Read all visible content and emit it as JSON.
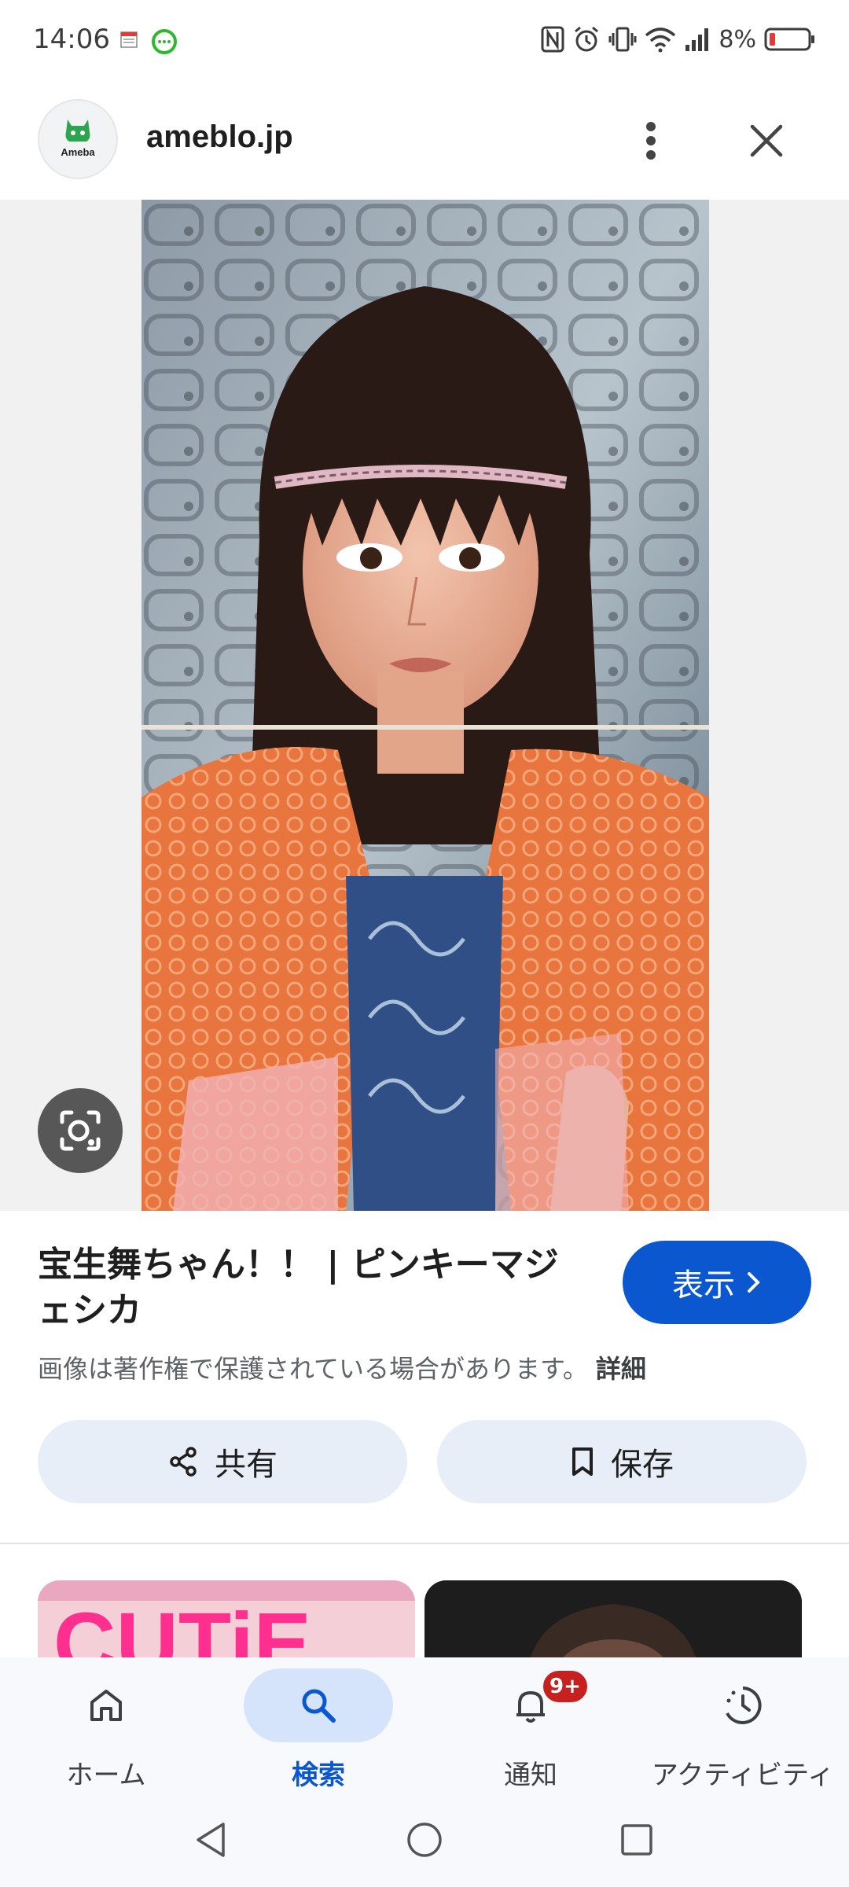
{
  "status_bar": {
    "time": "14:06",
    "battery": "8%",
    "icons": [
      "calendar-icon",
      "chat-icon",
      "nfc-icon",
      "alarm-icon",
      "vibrate-icon",
      "wifi-icon",
      "signal-icon",
      "battery-icon"
    ],
    "battery_color": "#e53935"
  },
  "header": {
    "logo_text": "Ameba",
    "domain": "ameblo.jp"
  },
  "image": {
    "title": "宝生舞ちゃん！！ | ピンキーマジェシカ",
    "visit_label": "表示",
    "copyright_notice": "画像は著作権で保護されている場合があります。",
    "details_label": "詳細"
  },
  "actions": {
    "share_label": "共有",
    "save_label": "保存"
  },
  "related": {
    "thumb1_text": "CUTiE"
  },
  "bottom_nav": {
    "items": [
      {
        "label": "ホーム",
        "icon": "home-icon"
      },
      {
        "label": "検索",
        "icon": "search-icon",
        "active": true
      },
      {
        "label": "通知",
        "icon": "bell-icon",
        "badge": "9+"
      },
      {
        "label": "アクティビティ",
        "icon": "activity-icon"
      }
    ]
  },
  "colors": {
    "accent": "#0b57d0",
    "chip_bg": "#e8eef7",
    "badge": "#c5221f"
  }
}
